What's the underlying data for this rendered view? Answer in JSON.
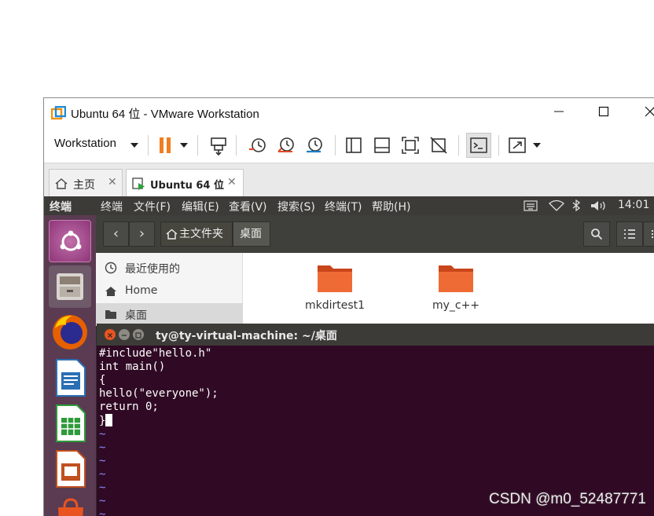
{
  "vmware": {
    "window_title": "Ubuntu 64 位 - VMware Workstation",
    "menu_label": "Workstation",
    "tabs": [
      {
        "label": "主页"
      },
      {
        "label": "Ubuntu 64 位"
      }
    ]
  },
  "ubuntu": {
    "topbar": {
      "app_name": "终端",
      "menus": [
        "终端",
        "文件(F)",
        "编辑(E)",
        "查看(V)",
        "搜索(S)",
        "终端(T)",
        "帮助(H)"
      ],
      "clock": "14:01"
    },
    "launcher": [
      "ubuntu-software-icon",
      "files-icon",
      "firefox-icon",
      "writer-icon",
      "calc-icon",
      "impress-icon",
      "software-center-icon"
    ],
    "files": {
      "breadcrumbs": [
        "主文件夹",
        "桌面"
      ],
      "sidebar": [
        "最近使用的",
        "Home",
        "桌面"
      ],
      "folders": [
        "mkdirtest1",
        "my_c++"
      ]
    },
    "terminal": {
      "title": "ty@ty-virtual-machine: ~/桌面",
      "lines": [
        "#include\"hello.h\"",
        "int main()",
        "{",
        "hello(\"everyone\");",
        "return 0;",
        "}"
      ],
      "tilde": "~"
    }
  },
  "watermark": "CSDN @m0_52487771",
  "colors": {
    "terminal_bg": "#300a24",
    "launcher_bg": "#5a3b52",
    "topbar_bg": "#3c3b37",
    "folder_orange": "#e95420"
  }
}
